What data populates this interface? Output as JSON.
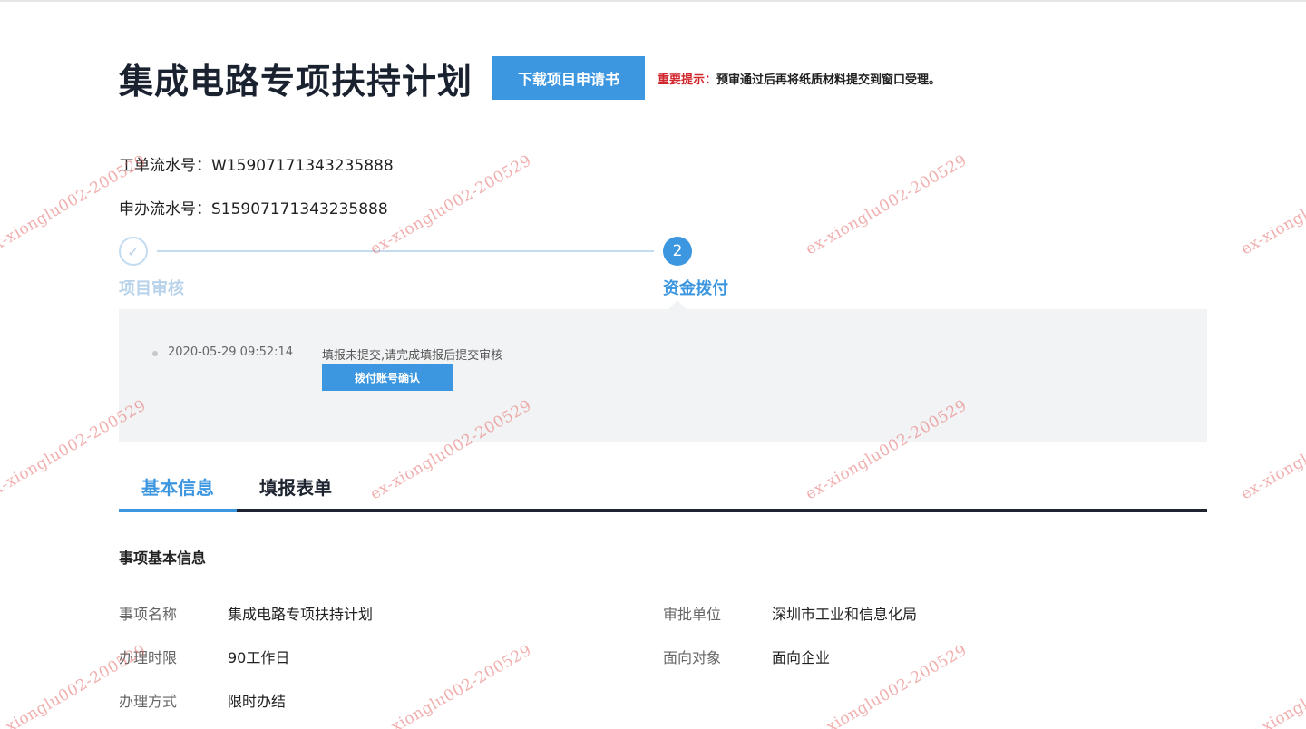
{
  "header": {
    "title": "集成电路专项扶持计划",
    "download_label": "下载项目申请书",
    "notice_label": "重要提示：",
    "notice_text": "预审通过后再将纸质材料提交到窗口受理。"
  },
  "serials": {
    "work_order": "工单流水号：W15907171343235888",
    "apply": "申办流水号：S15907171343235888"
  },
  "steps": [
    {
      "label": "项目审核",
      "marker": "✓",
      "state": "done"
    },
    {
      "label": "资金拨付",
      "marker": "2",
      "state": "active"
    }
  ],
  "timeline": {
    "time": "2020-05-29 09:52:14",
    "message": "填报未提交,请完成填报后提交审核",
    "button_label": "拨付账号确认"
  },
  "tabs": [
    {
      "label": "基本信息",
      "active": true
    },
    {
      "label": "填报表单",
      "active": false
    }
  ],
  "section": {
    "title": "事项基本信息",
    "fields": [
      {
        "label": "事项名称",
        "value": "集成电路专项扶持计划"
      },
      {
        "label": "审批单位",
        "value": "深圳市工业和信息化局"
      },
      {
        "label": "办理时限",
        "value": "90工作日"
      },
      {
        "label": "面向对象",
        "value": "面向企业"
      },
      {
        "label": "办理方式",
        "value": "限时办结"
      }
    ]
  },
  "watermark": "ex-xionglu002-200529",
  "colors": {
    "accent": "#3d97e0",
    "step_done": "#b8d3ea",
    "notice_red": "#d0262c",
    "dark": "#1e2530",
    "panel_bg": "#f2f3f4"
  }
}
